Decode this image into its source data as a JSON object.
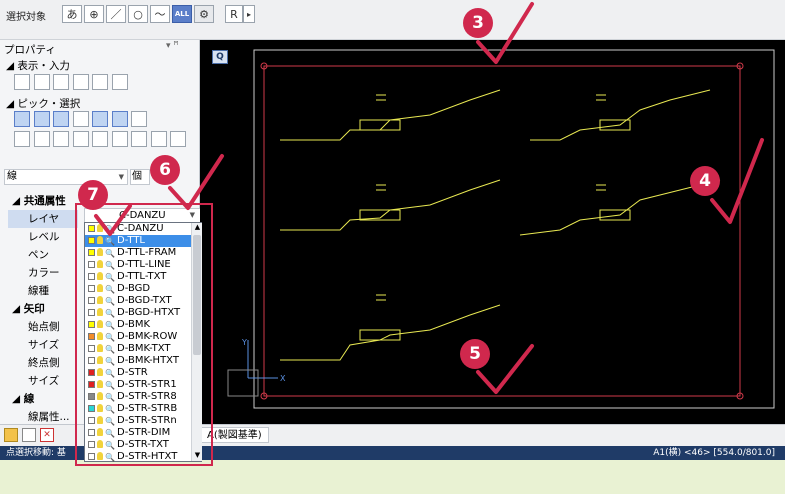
{
  "toolbar": {
    "select_target_label": "選択対象",
    "buttons": [
      "あ",
      "⊕",
      "／",
      "○",
      "〜",
      "ALL",
      "⚙"
    ],
    "r_label": "R",
    "arrow_label": "▸"
  },
  "properties_panel": {
    "title": "プロパティ",
    "pin": "▾ ꟸ",
    "section_display": "表示・入力",
    "section_pick": "ピック・選択",
    "combo_value": "線",
    "combo_right_partial": "個",
    "rows": [
      {
        "label": "共通属性",
        "category": true
      },
      {
        "label": "レイヤ",
        "selected": true
      },
      {
        "label": "レベル"
      },
      {
        "label": "ペン"
      },
      {
        "label": "カラー"
      },
      {
        "label": "線種"
      },
      {
        "label": "矢印",
        "category": true
      },
      {
        "label": "始点側"
      },
      {
        "label": "サイズ"
      },
      {
        "label": "終点側"
      },
      {
        "label": "サイズ"
      },
      {
        "label": "線",
        "category": true
      },
      {
        "label": "線属性..."
      }
    ],
    "layer_value": "C-DANZU"
  },
  "layer_dropdown": {
    "items": [
      {
        "name": "C-DANZU",
        "color": "#ffff00"
      },
      {
        "name": "D-TTL",
        "color": "#ffff00",
        "selected": true
      },
      {
        "name": "D-TTL-FRAM",
        "color": "#ffff00"
      },
      {
        "name": "D-TTL-LINE",
        "color": "#ffffff"
      },
      {
        "name": "D-TTL-TXT",
        "color": "#ffffff"
      },
      {
        "name": "D-BGD",
        "color": "#ffffff"
      },
      {
        "name": "D-BGD-TXT",
        "color": "#ffffff"
      },
      {
        "name": "D-BGD-HTXT",
        "color": "#ffffff"
      },
      {
        "name": "D-BMK",
        "color": "#ffff00"
      },
      {
        "name": "D-BMK-ROW",
        "color": "#f28c28"
      },
      {
        "name": "D-BMK-TXT",
        "color": "#ffffff"
      },
      {
        "name": "D-BMK-HTXT",
        "color": "#ffffff"
      },
      {
        "name": "D-STR",
        "color": "#e02020"
      },
      {
        "name": "D-STR-STR1",
        "color": "#e02020"
      },
      {
        "name": "D-STR-STR8",
        "color": "#888888"
      },
      {
        "name": "D-STR-STRB",
        "color": "#2ad6d6"
      },
      {
        "name": "D-STR-STRn",
        "color": "#ffffff"
      },
      {
        "name": "D-STR-DIM",
        "color": "#ffffff"
      },
      {
        "name": "D-STR-TXT",
        "color": "#ffffff"
      },
      {
        "name": "D-STR-HTXT",
        "color": "#ffffff"
      }
    ]
  },
  "canvas": {
    "q_button": "Q",
    "axis_y": "Y",
    "axis_x": "X"
  },
  "tabs": {
    "tab_partial": "A(製図基準)"
  },
  "status_bar": {
    "left": "点選択移動: 基",
    "right": "A1(横) <46> [554.0/801.0]"
  },
  "annotations": {
    "badges": [
      "3",
      "4",
      "5",
      "6",
      "7"
    ],
    "accent_color": "#d0284d"
  }
}
